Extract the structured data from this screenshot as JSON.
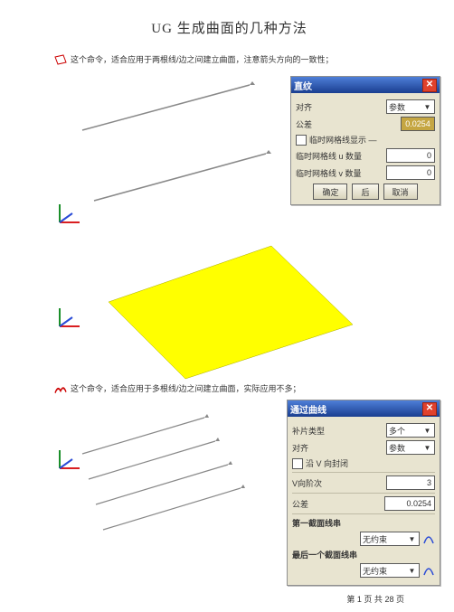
{
  "title": "UG 生成曲面的几种方法",
  "section1": {
    "desc": "这个命令，适合应用于两根线/边之间建立曲面，注意箭头方向的一致性；"
  },
  "dialog1": {
    "title": "直纹",
    "rows": {
      "align_label": "对齐",
      "align_value": "参数",
      "tol_label": "公差",
      "tol_value": "0.0254",
      "grid_display": "临时网格线显示 —",
      "grid_u_label": "临时网格线 u 数量",
      "grid_u_value": "0",
      "grid_v_label": "临时网格线 v 数量",
      "grid_v_value": "0"
    },
    "buttons": {
      "ok": "确定",
      "back": "后",
      "cancel": "取消"
    }
  },
  "section2": {
    "desc": "这个命令，适合应用于多根线/边之间建立曲面，实际应用不多；"
  },
  "dialog2": {
    "title": "通过曲线",
    "rows": {
      "patch_type_label": "补片类型",
      "patch_type_value": "多个",
      "align_label": "对齐",
      "align_value": "参数",
      "v_closed_label": "沿 V 向封闭",
      "v_deg_label": "V向阶次",
      "v_deg_value": "3",
      "tol_label": "公差",
      "tol_value": "0.0254",
      "first_sec_label": "第一截面线串",
      "last_sec_label": "最后一个截面线串",
      "constraint_value": "无约束"
    }
  },
  "footer": {
    "page_prefix": "第",
    "page_cur": "1",
    "page_mid": "页 共",
    "page_total": "28",
    "page_suffix": "页"
  },
  "icons": {
    "ruled": "ruled-surface-icon",
    "through": "through-curves-icon",
    "close": "close-icon",
    "arrow": "dropdown-arrow"
  }
}
